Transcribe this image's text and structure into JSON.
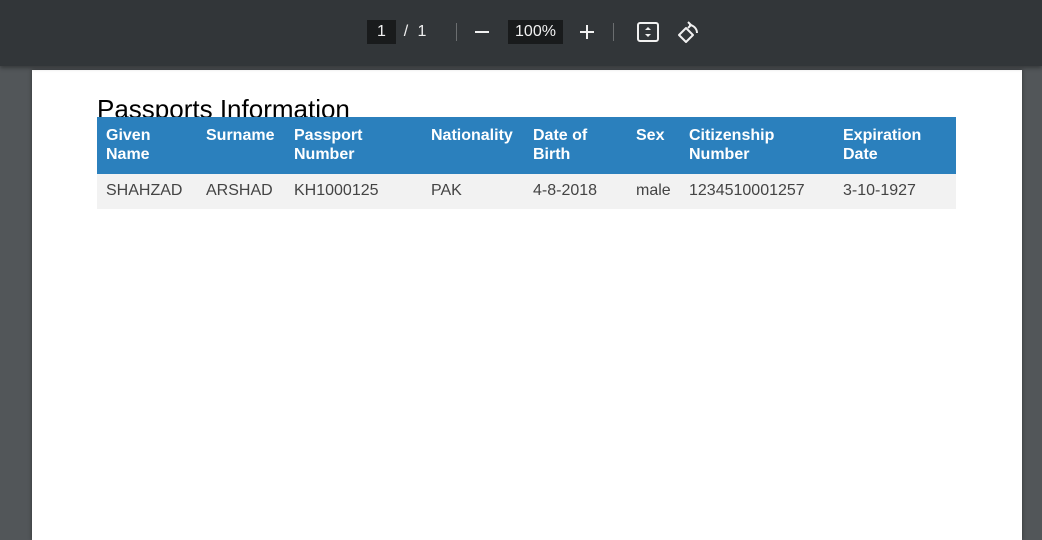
{
  "toolbar": {
    "current_page": "1",
    "page_separator": "/",
    "total_pages": "1",
    "zoom_level": "100%",
    "icons": [
      "zoom-out-icon",
      "zoom-in-icon",
      "fit-page-icon",
      "rotate-icon"
    ]
  },
  "document": {
    "title": "Passports Information",
    "table": {
      "headers": [
        "Given Name",
        "Surname",
        "Passport Number",
        "Nationality",
        "Date of Birth",
        "Sex",
        "Citizenship Number",
        "Expiration Date"
      ],
      "rows": [
        [
          "SHAHZAD",
          "ARSHAD",
          "KH1000125",
          "PAK",
          "4-8-2018",
          "male",
          "1234510001257",
          "3-10-1927"
        ]
      ]
    }
  },
  "colors": {
    "toolbar_bg": "#323639",
    "viewer_bg": "#525659",
    "header_bg": "#2b80bd",
    "row_bg": "#f2f2f2"
  }
}
